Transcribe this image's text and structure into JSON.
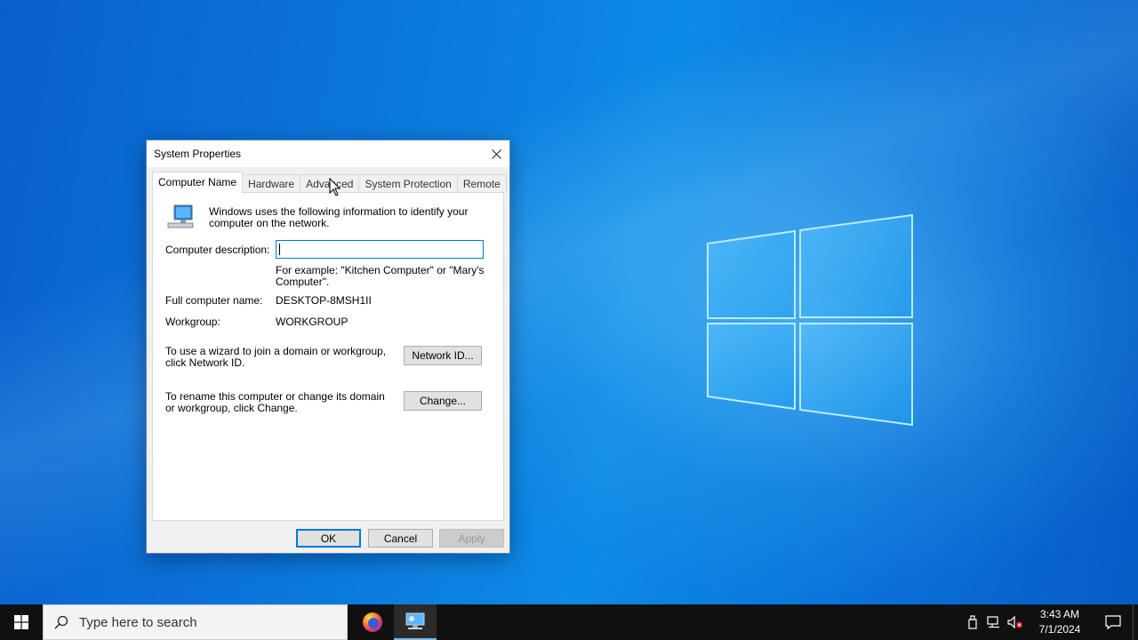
{
  "dialog": {
    "title": "System Properties",
    "tabs": [
      {
        "label": "Computer Name",
        "active": true
      },
      {
        "label": "Hardware",
        "active": false
      },
      {
        "label": "Advanced",
        "active": false
      },
      {
        "label": "System Protection",
        "active": false
      },
      {
        "label": "Remote",
        "active": false
      }
    ],
    "intro_text": "Windows uses the following information to identify your computer on the network.",
    "description_label": "Computer description:",
    "description_value": "",
    "example_text": "For example: \"Kitchen Computer\" or \"Mary's Computer\".",
    "full_name_label": "Full computer name:",
    "full_name_value": "DESKTOP-8MSH1II",
    "workgroup_label": "Workgroup:",
    "workgroup_value": "WORKGROUP",
    "network_id_text": "To use a wizard to join a domain or workgroup, click Network ID.",
    "network_id_button": "Network ID...",
    "rename_text": "To rename this computer or change its domain or workgroup, click Change.",
    "change_button": "Change...",
    "ok_button": "OK",
    "cancel_button": "Cancel",
    "apply_button": "Apply"
  },
  "taskbar": {
    "search_placeholder": "Type here to search",
    "clock_time": "3:43 AM",
    "clock_date": "7/1/2024",
    "apps": [
      "firefox-icon",
      "system-properties-icon"
    ]
  },
  "colors": {
    "accent": "#0078d7",
    "desktop_blue": "#0b79dc",
    "taskbar": "#101010"
  }
}
